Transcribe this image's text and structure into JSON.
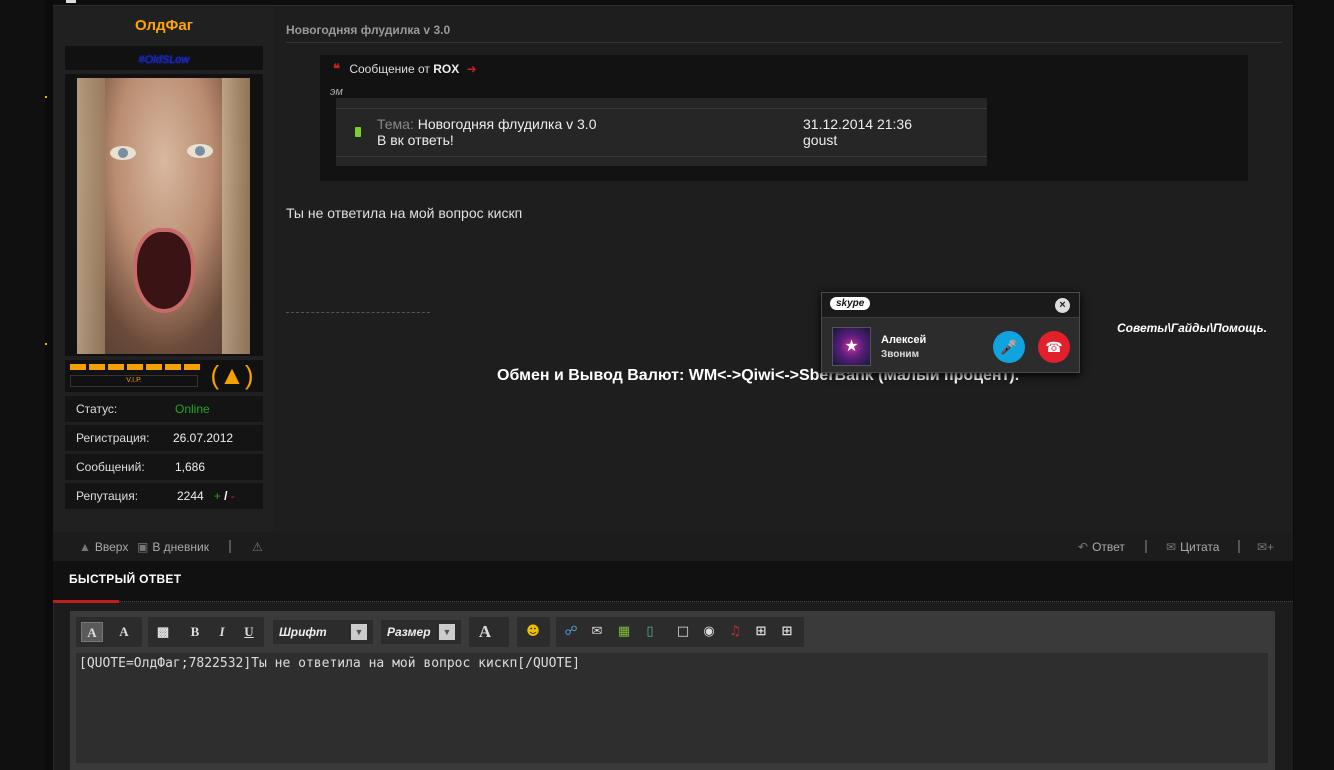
{
  "user": {
    "name": "ОлдФаг",
    "title": "#OldSLow",
    "vip_label": "V.I.P.",
    "stats": [
      {
        "label": "Статус:",
        "value": "Online"
      },
      {
        "label": "Регистрация:",
        "value": "26.07.2012"
      },
      {
        "label": "Сообщений:",
        "value": "1,686"
      },
      {
        "label": "Репутация:",
        "value": "2244"
      }
    ],
    "rep_plus": "+",
    "rep_sep": "/",
    "rep_minus": "-"
  },
  "post": {
    "title": "Новогодняя флудилка v 3.0",
    "quote": {
      "prefix": "Сообщение от",
      "author": "ROX",
      "em": "эм",
      "rows": [
        {
          "topic_key": "Тема:",
          "topic": "Новогодняя флудилка v 3.0",
          "text": "В вк ответь!",
          "date": "31.12.2014 21:36",
          "user": "goust"
        }
      ]
    },
    "text": "Ты не ответила на мой вопрос кискп",
    "sig_link": "Советы\\Гайды\\Помощь.",
    "sig_exchange": "Обмен и Вывод Валют: WM<->Qiwi<->SberBank (Малый процент)."
  },
  "skype": {
    "logo": "skype",
    "caller": "Алексей",
    "status": "Звоним"
  },
  "footer": {
    "up": "Вверх",
    "diary": "В дневник",
    "reply": "Ответ",
    "quote": "Цитата"
  },
  "quick_reply": {
    "title": "БЫСТРЫЙ ОТВЕТ",
    "font_label": "Шрифт",
    "size_label": "Размер",
    "text": "[QUOTE=ОлдФаг;7822532]Ты не ответила на мой вопрос кискп[/QUOTE]"
  }
}
